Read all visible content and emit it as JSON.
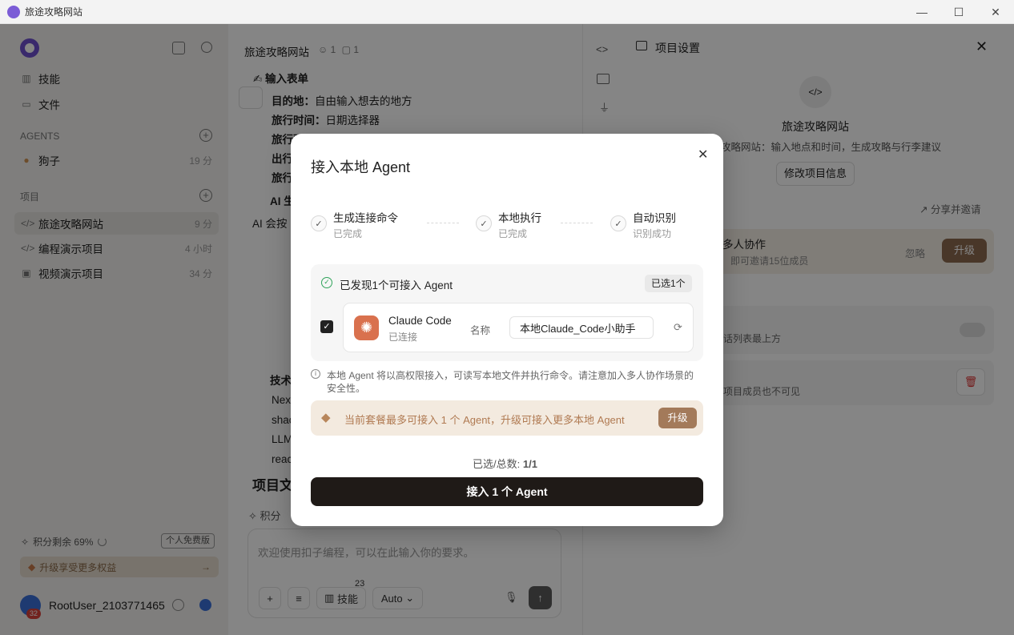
{
  "window": {
    "title": "旅途攻略网站"
  },
  "sidebar": {
    "nav": [
      {
        "label": "技能"
      },
      {
        "label": "文件"
      }
    ],
    "agents_header": "AGENTS",
    "agents": [
      {
        "label": "狗子",
        "meta": "19 分"
      }
    ],
    "projects_header": "项目",
    "projects": [
      {
        "label": "旅途攻略网站",
        "meta": "9 分"
      },
      {
        "label": "编程演示项目",
        "meta": "4 小时"
      },
      {
        "label": "视频演示项目",
        "meta": "34 分"
      }
    ],
    "credits": "积分剩余 69%",
    "free_badge": "个人免费版",
    "upgrade_banner": "升级享受更多权益",
    "user": {
      "name": "RootUser_2103771465",
      "badge": "32"
    }
  },
  "chat": {
    "title": "旅途攻略网站",
    "members": "1",
    "agents_count": "1",
    "form_heading": "✍ 输入表单",
    "lines": [
      {
        "key": "目的地：",
        "value": "自由输入想去的地方"
      },
      {
        "key": "旅行时间：",
        "value": "日期选择器"
      },
      {
        "key": "旅行预",
        "value": ""
      },
      {
        "key": "出行",
        "value": ""
      },
      {
        "key": "旅行",
        "value": ""
      }
    ],
    "ai_heading": "AI 生",
    "ai_text": "AI 会按",
    "tech_heading": "技术",
    "tech_items": [
      "Nex",
      "shac",
      "LLM",
      "reac"
    ],
    "doc_heading": "项目文",
    "credits_hint": "积分",
    "input_placeholder": "欢迎使用扣子编程，可以在此输入你的要求。",
    "skills_label": "技能",
    "skills_count": "23",
    "model_label": "Auto"
  },
  "right": {
    "header": "项目设置",
    "project_name": "旅途攻略网站",
    "project_desc": "攻略网站：输入地点和时间，生成攻略与行李建议",
    "edit_button": "修改项目信息",
    "share_link": "分享并邀请",
    "collab_title": "多人协作",
    "collab_desc": "即可邀请15位成员",
    "ignore": "忽略",
    "upgrade": "升级",
    "toggle_text": "话列表最上方",
    "hidden_text": "项目成员也不可见"
  },
  "modal": {
    "title": "接入本地 Agent",
    "steps": [
      {
        "title": "生成连接命令",
        "status": "已完成"
      },
      {
        "title": "本地执行",
        "status": "已完成"
      },
      {
        "title": "自动识别",
        "status": "识别成功"
      }
    ],
    "found_text": "已发现1个可接入 Agent",
    "selected_badge": "已选1个",
    "agent": {
      "name": "Claude Code",
      "status": "已连接",
      "name_label": "名称",
      "name_value": "本地Claude_Code小助手"
    },
    "warning": "本地 Agent 将以高权限接入，可读写本地文件并执行命令。请注意加入多人协作场景的安全性。",
    "plan_notice": "当前套餐最多可接入 1 个 Agent，升级可接入更多本地 Agent",
    "plan_upgrade": "升级",
    "count_label": "已选/总数:",
    "count_value": "1/1",
    "connect_button": "接入 1 个 Agent"
  }
}
